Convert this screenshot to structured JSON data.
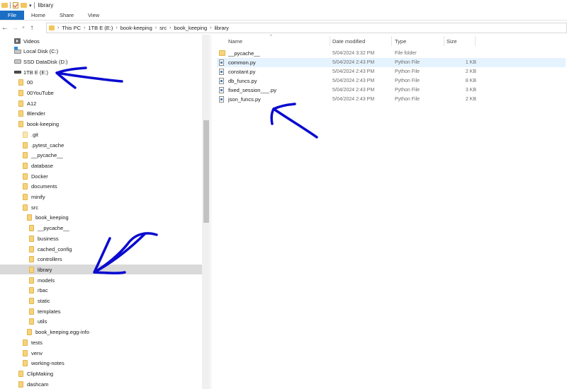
{
  "window": {
    "title": "library"
  },
  "ribbon": {
    "tabs": [
      "File",
      "Home",
      "Share",
      "View"
    ]
  },
  "address": {
    "crumbs": [
      "This PC",
      "1TB E (E:)",
      "book-keeping",
      "src",
      "book_keeping",
      "library"
    ]
  },
  "nav_tree": [
    {
      "label": "Videos",
      "icon": "videos-icon",
      "indent": 0
    },
    {
      "label": "Local Disk (C:)",
      "icon": "windows-drive-icon",
      "indent": 0
    },
    {
      "label": "SSD DataDisk (D:)",
      "icon": "drive-icon",
      "indent": 0
    },
    {
      "label": "1TB E (E:)",
      "icon": "drive-icon",
      "indent": 0
    },
    {
      "label": "00",
      "icon": "folder-icon",
      "indent": 1
    },
    {
      "label": "00YouTube",
      "icon": "folder-icon",
      "indent": 1
    },
    {
      "label": "A12",
      "icon": "folder-icon",
      "indent": 1
    },
    {
      "label": "Blender",
      "icon": "folder-icon",
      "indent": 1
    },
    {
      "label": "book-keeping",
      "icon": "folder-icon",
      "indent": 1
    },
    {
      "label": ".git",
      "icon": "folder-icon",
      "indent": 2,
      "pale": true
    },
    {
      "label": ".pytest_cache",
      "icon": "folder-icon",
      "indent": 2
    },
    {
      "label": "__pycache__",
      "icon": "folder-icon",
      "indent": 2
    },
    {
      "label": "database",
      "icon": "folder-icon",
      "indent": 2
    },
    {
      "label": "Docker",
      "icon": "folder-icon",
      "indent": 2
    },
    {
      "label": "documents",
      "icon": "folder-icon",
      "indent": 2
    },
    {
      "label": "minify",
      "icon": "folder-icon",
      "indent": 2
    },
    {
      "label": "src",
      "icon": "folder-icon",
      "indent": 2
    },
    {
      "label": "book_keeping",
      "icon": "folder-icon",
      "indent": 3
    },
    {
      "label": "__pycache__",
      "icon": "folder-icon",
      "indent": 4
    },
    {
      "label": "business",
      "icon": "folder-icon",
      "indent": 4
    },
    {
      "label": "cached_config",
      "icon": "folder-icon",
      "indent": 4
    },
    {
      "label": "controllers",
      "icon": "folder-icon",
      "indent": 4
    },
    {
      "label": "library",
      "icon": "folder-icon",
      "indent": 4,
      "selected": true
    },
    {
      "label": "models",
      "icon": "folder-icon",
      "indent": 4
    },
    {
      "label": "rbac",
      "icon": "folder-icon",
      "indent": 4
    },
    {
      "label": "static",
      "icon": "folder-icon",
      "indent": 4
    },
    {
      "label": "templates",
      "icon": "folder-icon",
      "indent": 4
    },
    {
      "label": "utils",
      "icon": "folder-icon",
      "indent": 4
    },
    {
      "label": "book_keeping.egg-info",
      "icon": "folder-icon",
      "indent": 3
    },
    {
      "label": "tests",
      "icon": "folder-icon",
      "indent": 2
    },
    {
      "label": "venv",
      "icon": "folder-icon",
      "indent": 2
    },
    {
      "label": "working-notes",
      "icon": "folder-icon",
      "indent": 2
    },
    {
      "label": "ClipMaking",
      "icon": "folder-icon",
      "indent": 1
    },
    {
      "label": "dashcam",
      "icon": "folder-icon",
      "indent": 1
    }
  ],
  "columns": {
    "name": "Name",
    "date": "Date modified",
    "type": "Type",
    "size": "Size"
  },
  "files": [
    {
      "name": "__pycache__",
      "date": "5/04/2024 3:32 PM",
      "type": "File folder",
      "size": "",
      "kind": "folder"
    },
    {
      "name": "common.py",
      "date": "5/04/2024 2:43 PM",
      "type": "Python File",
      "size": "1 KB",
      "kind": "py",
      "highlight": true
    },
    {
      "name": "constant.py",
      "date": "5/04/2024 2:43 PM",
      "type": "Python File",
      "size": "2 KB",
      "kind": "py"
    },
    {
      "name": "db_funcs.py",
      "date": "5/04/2024 2:43 PM",
      "type": "Python File",
      "size": "8 KB",
      "kind": "py"
    },
    {
      "name": "fixed_session___.py",
      "date": "5/04/2024 2:43 PM",
      "type": "Python File",
      "size": "3 KB",
      "kind": "py"
    },
    {
      "name": "json_funcs.py",
      "date": "5/04/2024 2:43 PM",
      "type": "Python File",
      "size": "2 KB",
      "kind": "py"
    }
  ],
  "colors": {
    "accent": "#1a6fc4",
    "annotation": "#0a0ad0",
    "selected_row": "#d9d9d9",
    "hover_row": "#e5f3ff"
  }
}
